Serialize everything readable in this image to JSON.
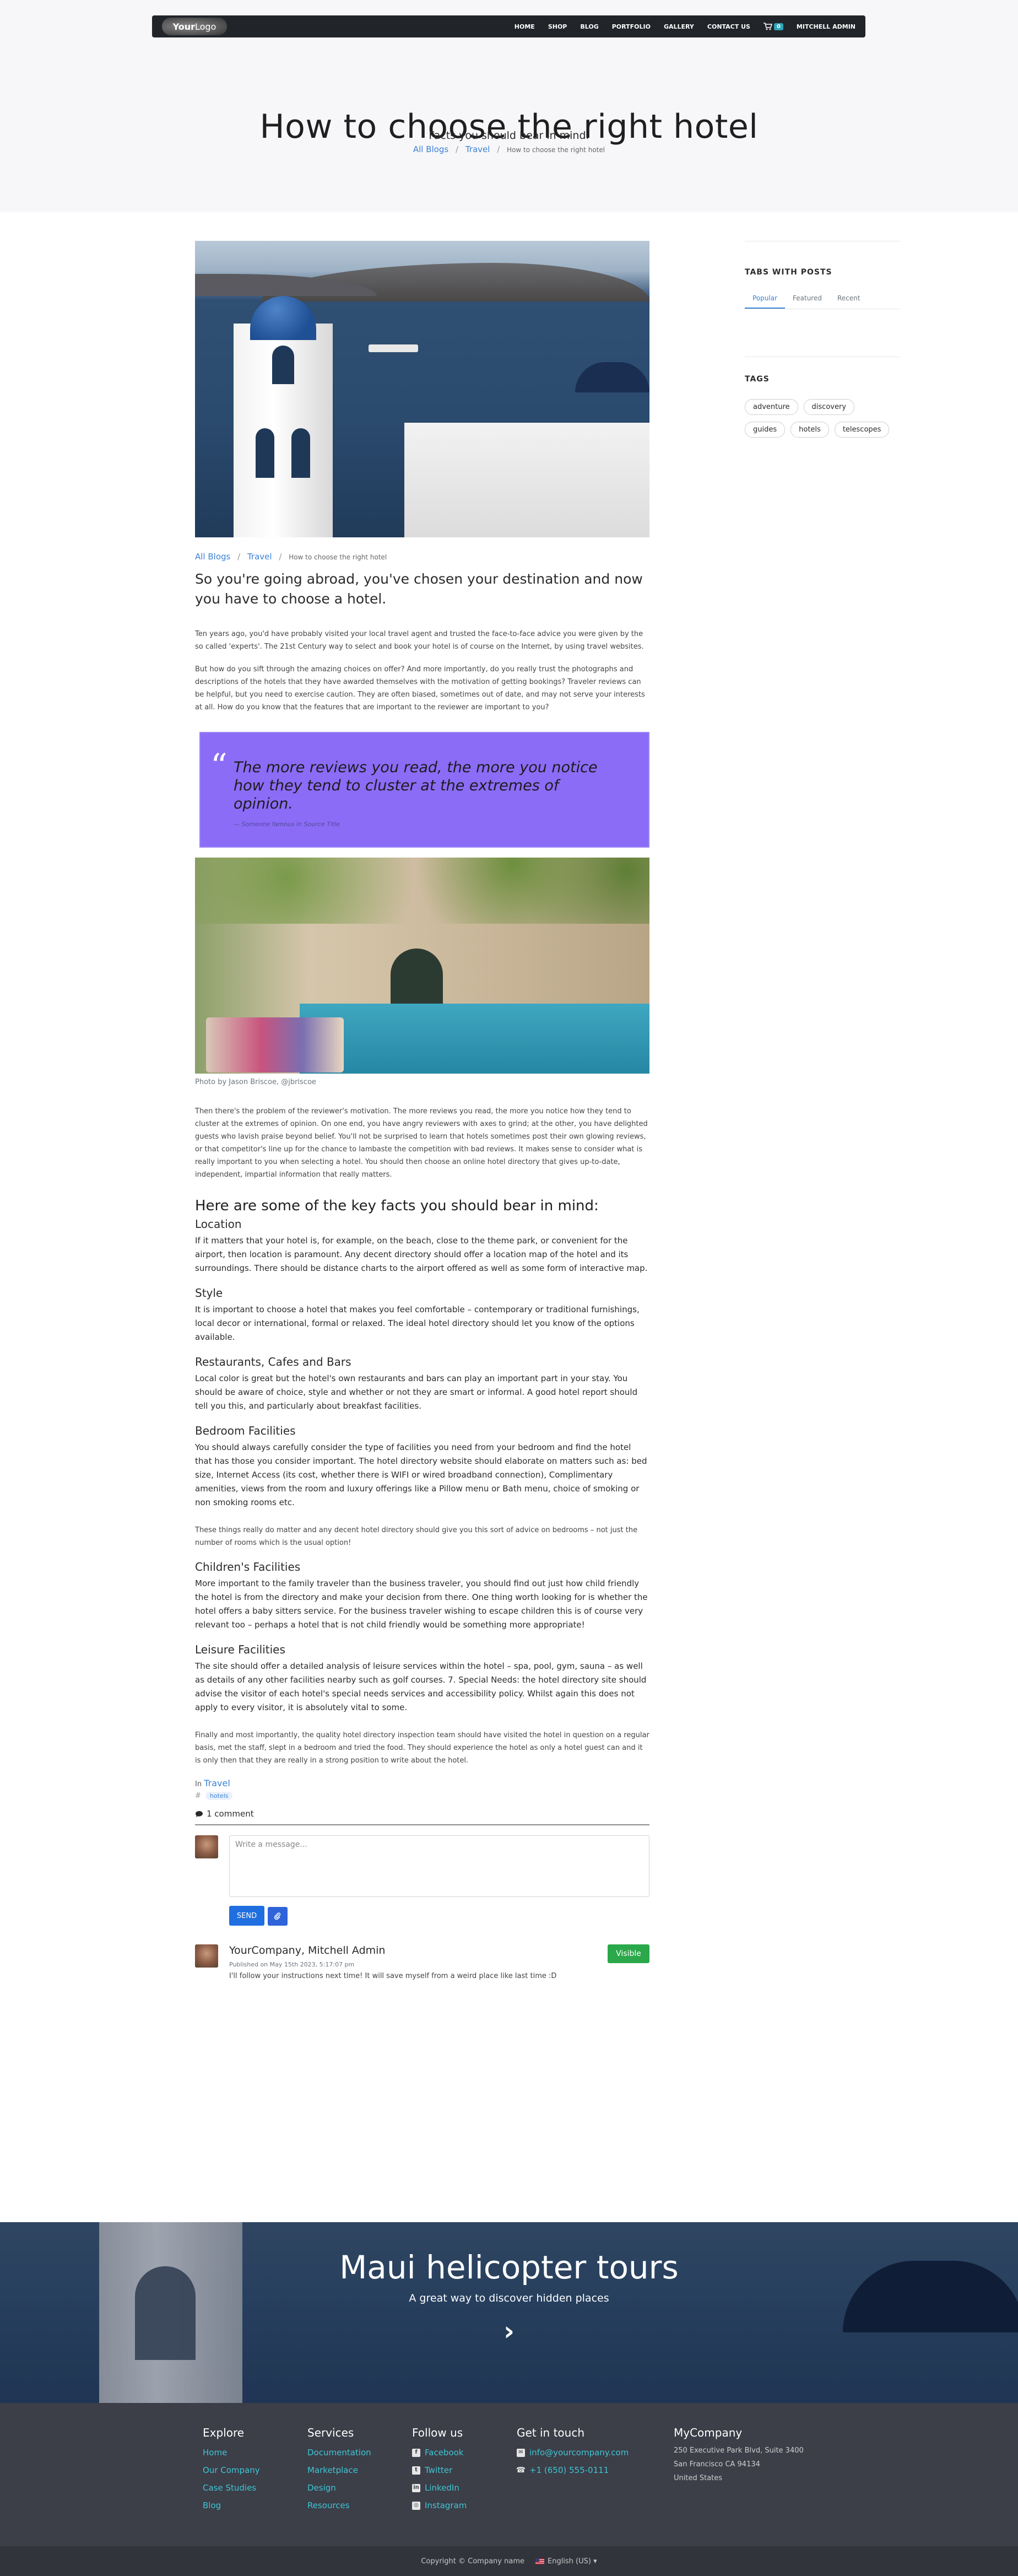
{
  "colors": {
    "accent": "#3b82d6",
    "quote_bg": "#8b6cf7",
    "send": "#1f6fe0",
    "visible": "#2aa84a",
    "footer_bg": "#3c3e48",
    "footer_link": "#3ec6d4"
  },
  "nav": {
    "logo_bold": "Your",
    "logo_rest": "Logo",
    "items": [
      "HOME",
      "SHOP",
      "BLOG",
      "PORTFOLIO",
      "GALLERY",
      "CONTACT US"
    ],
    "cart_count": "0",
    "user": "MITCHELL ADMIN",
    "cart_icon": "shopping-cart-icon"
  },
  "hero": {
    "title": "How to choose the right hotel",
    "subtitle": "Facts you should bear in mind.",
    "breadcrumb": {
      "all": "All Blogs",
      "blog": "Travel",
      "current": "How to choose the right hotel",
      "sep": "/"
    }
  },
  "post": {
    "intro": "So you're going abroad, you've chosen your destination and now you have to choose a hotel.",
    "p1": "Ten years ago, you'd have probably visited your local travel agent and trusted the face-to-face advice you were given by the so called 'experts'. The 21st Century way to select and book your hotel is of course on the Internet, by using travel websites.",
    "p2": "But how do you sift through the amazing choices on offer? And more importantly, do you really trust the photographs and descriptions of the hotels that they have awarded themselves with the motivation of getting bookings? Traveler reviews can be helpful, but you need to exercise caution. They are often biased, sometimes out of date, and may not serve your interests at all. How do you know that the features that are important to the reviewer are important to you?",
    "quote": {
      "mark": "“",
      "text": "The more reviews you read, the more you notice how they tend to cluster at the extremes of opinion.",
      "cite": "— Someone famous in Source Title"
    },
    "photo_caption": "Photo by Jason Briscoe, @jbriscoe",
    "p3": "Then there's the problem of the reviewer's motivation. The more reviews you read, the more you notice how they tend to cluster at the extremes of opinion. On one end, you have angry reviewers with axes to grind; at the other, you have delighted guests who lavish praise beyond belief. You'll not be surprised to learn that hotels sometimes post their own glowing reviews, or that competitor's line up for the chance to lambaste the competition with bad reviews. It makes sense to consider what is really important to you when selecting a hotel. You should then choose an online hotel directory that gives up-to-date, independent, impartial information that really matters.",
    "h2": "Here are some of the key facts you should bear in mind:",
    "sections": [
      {
        "title": "Location",
        "text": "If it matters that your hotel is, for example, on the beach, close to the theme park, or convenient for the airport, then location is paramount. Any decent directory should offer a location map of the hotel and its surroundings. There should be distance charts to the airport offered as well as some form of interactive map."
      },
      {
        "title": "Style",
        "text": "It is important to choose a hotel that makes you feel comfortable – contemporary or traditional furnishings, local decor or international, formal or relaxed. The ideal hotel directory should let you know of the options available."
      },
      {
        "title": "Restaurants, Cafes and Bars",
        "text": "Local color is great but the hotel's own restaurants and bars can play an important part in your stay. You should be aware of choice, style and whether or not they are smart or informal. A good hotel report should tell you this, and particularly about breakfast facilities."
      },
      {
        "title": "Bedroom Facilities",
        "text": "You should always carefully consider the type of facilities you need from your bedroom and find the hotel that has those you consider important. The hotel directory website should elaborate on matters such as: bed size, Internet Access (its cost, whether there is WIFI or wired broadband connection), Complimentary amenities, views from the room and luxury offerings like a Pillow menu or Bath menu, choice of smoking or non smoking rooms etc."
      }
    ],
    "p4": "These things really do matter and any decent hotel directory should give you this sort of advice on bedrooms – not just the number of rooms which is the usual option!",
    "sections2": [
      {
        "title": "Children's Facilities",
        "text": "More important to the family traveler than the business traveler, you should find out just how child friendly the hotel is from the directory and make your decision from there. One thing worth looking for is whether the hotel offers a baby sitters service. For the business traveler wishing to escape children this is of course very relevant too – perhaps a hotel that is not child friendly would be something more appropriate!"
      },
      {
        "title": "Leisure Facilities",
        "text": "The site should offer a detailed analysis of leisure services within the hotel – spa, pool, gym, sauna – as well as details of any other facilities nearby such as golf courses. 7. Special Needs: the hotel directory site should advise the visitor of each hotel's special needs services and accessibility policy. Whilst again this does not apply to every visitor, it is absolutely vital to some."
      }
    ],
    "p5": "Finally and most importantly, the quality hotel directory inspection team should have visited the hotel in question on a regular basis, met the staff, slept in a bedroom and tried the food. They should experience the hotel as only a hotel guest can and it is only then that they are really in a strong position to write about the hotel.",
    "in_label": "In",
    "in_blog": "Travel",
    "hash": "#",
    "tag": "hotels"
  },
  "comments": {
    "count": "1 comment",
    "icon": "comment-icon",
    "placeholder": "Write a message...",
    "send": "SEND",
    "attach_icon": "paperclip-icon",
    "items": [
      {
        "author": "YourCompany, Mitchell Admin",
        "date": "Published on May 15th 2023, 5:17:07 pm",
        "text": "I'll follow your instructions next time! It will save myself from a weird place like last time :D",
        "status": "Visible"
      }
    ]
  },
  "sidebar": {
    "tabs_title": "TABS WITH POSTS",
    "tabs": [
      "Popular",
      "Featured",
      "Recent"
    ],
    "tags_title": "TAGS",
    "tags": [
      "adventure",
      "discovery",
      "guides",
      "hotels",
      "telescopes"
    ]
  },
  "banner": {
    "title": "Maui helicopter tours",
    "subtitle": "A great way to discover hidden places",
    "arrow": "›",
    "arrow_icon": "chevron-right-icon"
  },
  "footer": {
    "explore": {
      "title": "Explore",
      "links": [
        "Home",
        "Our Company",
        "Case Studies",
        "Blog"
      ]
    },
    "services": {
      "title": "Services",
      "links": [
        "Documentation",
        "Marketplace",
        "Design",
        "Resources"
      ]
    },
    "follow": {
      "title": "Follow us",
      "links": [
        {
          "label": "Facebook",
          "glyph": "f"
        },
        {
          "label": "Twitter",
          "glyph": "t"
        },
        {
          "label": "LinkedIn",
          "glyph": "in"
        },
        {
          "label": "Instagram",
          "glyph": "◎"
        }
      ]
    },
    "contact": {
      "title": "Get in touch",
      "email": "info@yourcompany.com",
      "phone": "+1 (650) 555-0111",
      "email_glyph": "✉",
      "phone_glyph": "☎"
    },
    "company": {
      "title": "MyCompany",
      "lines": [
        "250 Executive Park Blvd, Suite 3400",
        "San Francisco CA 94134",
        "United States"
      ]
    }
  },
  "bottom": {
    "copyright": "Copyright © Company name",
    "language": "English (US)",
    "caret": "▾"
  }
}
